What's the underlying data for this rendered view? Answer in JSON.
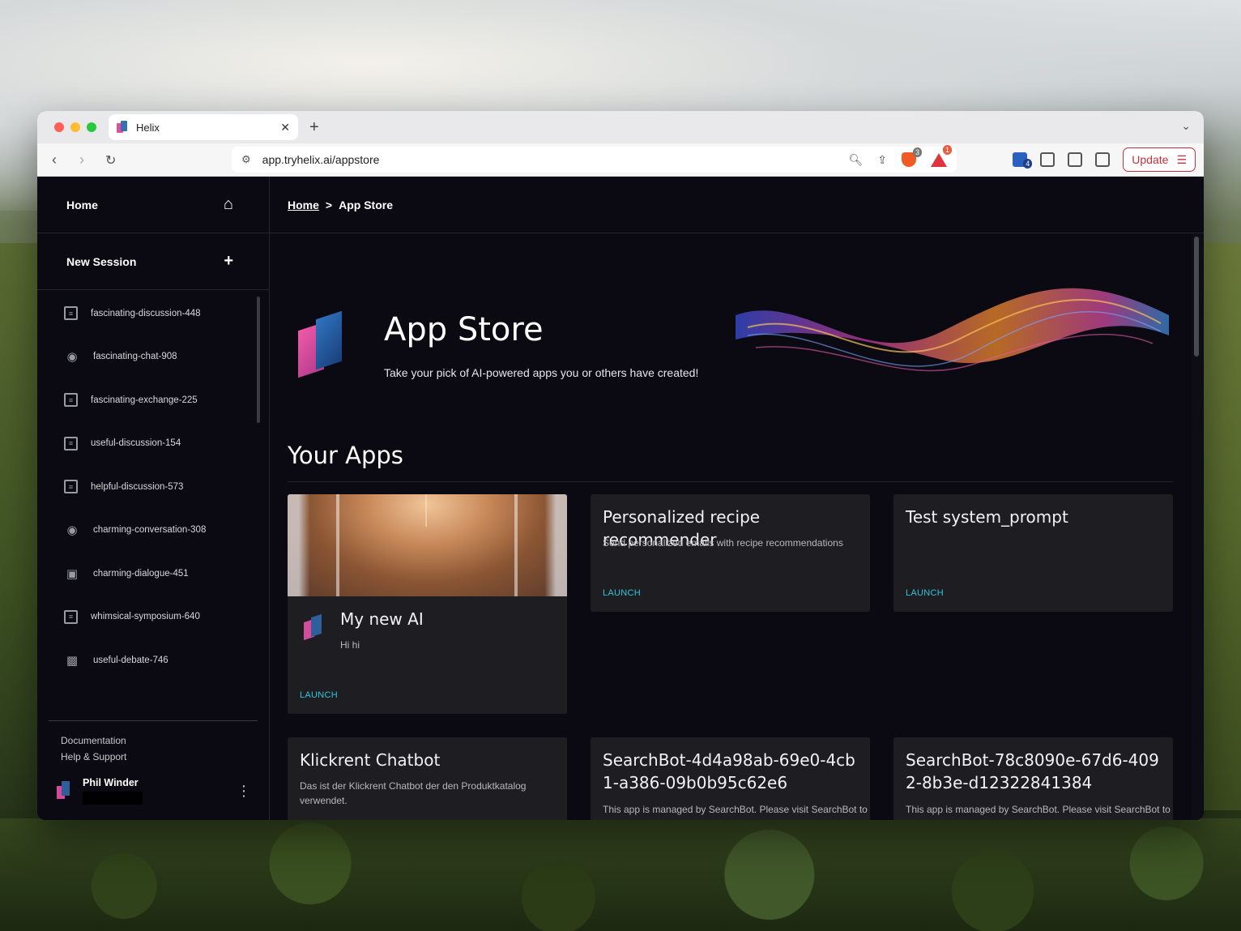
{
  "browser": {
    "tab_title": "Helix",
    "url": "app.tryhelix.ai/appstore",
    "shield_badge": "3",
    "alert_badge": "1",
    "extension_badge": "4",
    "update_label": "Update"
  },
  "sidebar": {
    "home_label": "Home",
    "new_session_label": "New Session",
    "sessions": [
      {
        "label": "fascinating-discussion-448",
        "icon": "text-session-icon"
      },
      {
        "label": "fascinating-chat-908",
        "icon": "finetune-session-icon"
      },
      {
        "label": "fascinating-exchange-225",
        "icon": "text-session-icon"
      },
      {
        "label": "useful-discussion-154",
        "icon": "text-session-icon"
      },
      {
        "label": "helpful-discussion-573",
        "icon": "text-session-icon"
      },
      {
        "label": "charming-conversation-308",
        "icon": "finetune-session-icon"
      },
      {
        "label": "charming-dialogue-451",
        "icon": "image-collection-icon"
      },
      {
        "label": "whimsical-symposium-640",
        "icon": "text-session-icon"
      },
      {
        "label": "useful-debate-746",
        "icon": "image-session-icon"
      }
    ],
    "links": {
      "documentation": "Documentation",
      "help": "Help & Support"
    },
    "user_name": "Phil Winder"
  },
  "breadcrumb": {
    "home": "Home",
    "separator": ">",
    "current": "App Store"
  },
  "hero": {
    "title": "App Store",
    "subtitle": "Take your pick of AI-powered apps you or others have created!"
  },
  "section_title": "Your Apps",
  "apps": [
    {
      "title": "My new AI",
      "description": "Hi hi",
      "launch": "LAUNCH"
    },
    {
      "title": "Personalized recipe recommender",
      "description": "Send personalized emails with recipe recommendations",
      "launch": "LAUNCH"
    },
    {
      "title": "Test system_prompt",
      "description": "",
      "launch": "LAUNCH"
    },
    {
      "title": "Klickrent Chatbot",
      "description": "Das ist der Klickrent Chatbot der den Produktkatalog verwendet."
    },
    {
      "title": "SearchBot-4d4a98ab-69e0-4cb1-a386-09b0b95c62e6",
      "description": "This app is managed by SearchBot. Please visit SearchBot to"
    },
    {
      "title": "SearchBot-78c8090e-67d6-4092-8b3e-d12322841384",
      "description": "This app is managed by SearchBot. Please visit SearchBot to"
    }
  ],
  "colors": {
    "accent": "#2ec6dc",
    "background": "#0b0a12",
    "card": "#1e1e22",
    "update": "#c4313b"
  }
}
